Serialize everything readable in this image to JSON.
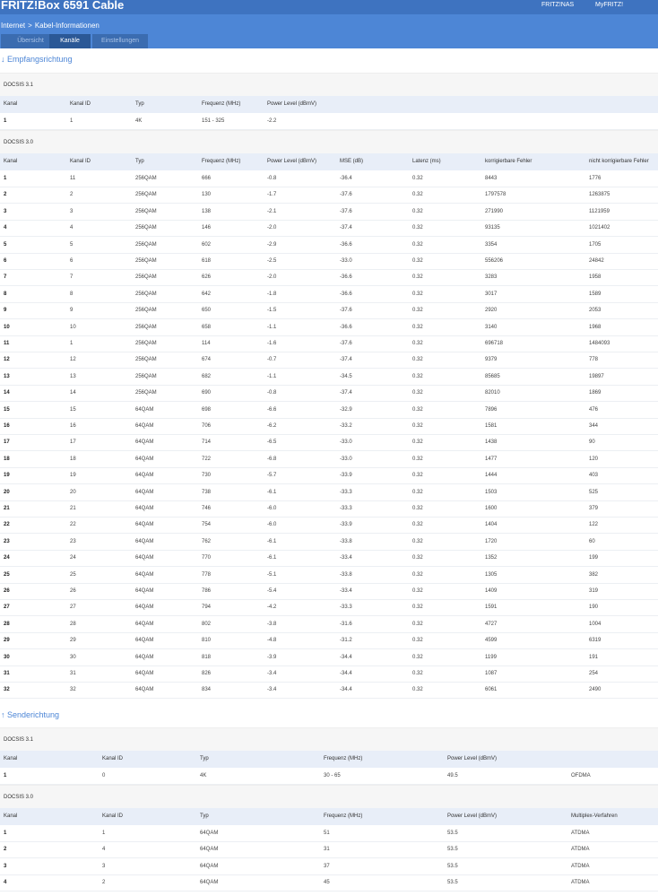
{
  "header": {
    "logo": "FRITZ!Box 6591 Cable",
    "links": [
      "FRITZ!NAS",
      "MyFRITZ!"
    ]
  },
  "breadcrumb": {
    "parent": "Internet",
    "separator": ">",
    "current": "Kabel-Informationen"
  },
  "tabs": [
    {
      "label": "Übersicht",
      "active": false
    },
    {
      "label": "Kanäle",
      "active": true
    },
    {
      "label": "Einstellungen",
      "active": false
    }
  ],
  "downstream": {
    "title": "↓ Empfangsrichtung",
    "docsis31": {
      "label": "DOCSIS 3.1",
      "headers": [
        "Kanal",
        "Kanal ID",
        "Typ",
        "Frequenz (MHz)",
        "Power Level (dBmV)"
      ],
      "rows": [
        [
          "1",
          "1",
          "4K",
          "151 - 325",
          "-2.2"
        ]
      ]
    },
    "docsis30": {
      "label": "DOCSIS 3.0",
      "headers": [
        "Kanal",
        "Kanal ID",
        "Typ",
        "Frequenz (MHz)",
        "Power Level (dBmV)",
        "MSE (dB)",
        "Latenz (ms)",
        "korrigierbare Fehler",
        "nicht korrigierbare Fehler"
      ],
      "rows": [
        [
          "1",
          "11",
          "256QAM",
          "666",
          "-0.8",
          "-36.4",
          "0.32",
          "8443",
          "1776"
        ],
        [
          "2",
          "2",
          "256QAM",
          "130",
          "-1.7",
          "-37.6",
          "0.32",
          "1797578",
          "1263875"
        ],
        [
          "3",
          "3",
          "256QAM",
          "138",
          "-2.1",
          "-37.6",
          "0.32",
          "271990",
          "1121959"
        ],
        [
          "4",
          "4",
          "256QAM",
          "146",
          "-2.0",
          "-37.4",
          "0.32",
          "93135",
          "1021402"
        ],
        [
          "5",
          "5",
          "256QAM",
          "602",
          "-2.9",
          "-36.6",
          "0.32",
          "3354",
          "1705"
        ],
        [
          "6",
          "6",
          "256QAM",
          "618",
          "-2.5",
          "-33.0",
          "0.32",
          "556206",
          "24842"
        ],
        [
          "7",
          "7",
          "256QAM",
          "626",
          "-2.0",
          "-36.6",
          "0.32",
          "3283",
          "1958"
        ],
        [
          "8",
          "8",
          "256QAM",
          "642",
          "-1.8",
          "-36.6",
          "0.32",
          "3017",
          "1589"
        ],
        [
          "9",
          "9",
          "256QAM",
          "650",
          "-1.5",
          "-37.6",
          "0.32",
          "2920",
          "2053"
        ],
        [
          "10",
          "10",
          "256QAM",
          "658",
          "-1.1",
          "-36.6",
          "0.32",
          "3140",
          "1968"
        ],
        [
          "11",
          "1",
          "256QAM",
          "114",
          "-1.6",
          "-37.6",
          "0.32",
          "696718",
          "1484093"
        ],
        [
          "12",
          "12",
          "256QAM",
          "674",
          "-0.7",
          "-37.4",
          "0.32",
          "9379",
          "778"
        ],
        [
          "13",
          "13",
          "256QAM",
          "682",
          "-1.1",
          "-34.5",
          "0.32",
          "85685",
          "19897"
        ],
        [
          "14",
          "14",
          "256QAM",
          "690",
          "-0.8",
          "-37.4",
          "0.32",
          "82010",
          "1869"
        ],
        [
          "15",
          "15",
          "64QAM",
          "698",
          "-6.6",
          "-32.9",
          "0.32",
          "7896",
          "476"
        ],
        [
          "16",
          "16",
          "64QAM",
          "706",
          "-6.2",
          "-33.2",
          "0.32",
          "1581",
          "344"
        ],
        [
          "17",
          "17",
          "64QAM",
          "714",
          "-6.5",
          "-33.0",
          "0.32",
          "1438",
          "90"
        ],
        [
          "18",
          "18",
          "64QAM",
          "722",
          "-6.8",
          "-33.0",
          "0.32",
          "1477",
          "120"
        ],
        [
          "19",
          "19",
          "64QAM",
          "730",
          "-5.7",
          "-33.9",
          "0.32",
          "1444",
          "403"
        ],
        [
          "20",
          "20",
          "64QAM",
          "738",
          "-6.1",
          "-33.3",
          "0.32",
          "1503",
          "525"
        ],
        [
          "21",
          "21",
          "64QAM",
          "746",
          "-6.0",
          "-33.3",
          "0.32",
          "1600",
          "379"
        ],
        [
          "22",
          "22",
          "64QAM",
          "754",
          "-6.0",
          "-33.9",
          "0.32",
          "1404",
          "122"
        ],
        [
          "23",
          "23",
          "64QAM",
          "762",
          "-6.1",
          "-33.8",
          "0.32",
          "1720",
          "60"
        ],
        [
          "24",
          "24",
          "64QAM",
          "770",
          "-6.1",
          "-33.4",
          "0.32",
          "1352",
          "199"
        ],
        [
          "25",
          "25",
          "64QAM",
          "778",
          "-5.1",
          "-33.8",
          "0.32",
          "1305",
          "382"
        ],
        [
          "26",
          "26",
          "64QAM",
          "786",
          "-5.4",
          "-33.4",
          "0.32",
          "1409",
          "319"
        ],
        [
          "27",
          "27",
          "64QAM",
          "794",
          "-4.2",
          "-33.3",
          "0.32",
          "1591",
          "190"
        ],
        [
          "28",
          "28",
          "64QAM",
          "802",
          "-3.8",
          "-31.6",
          "0.32",
          "4727",
          "1004"
        ],
        [
          "29",
          "29",
          "64QAM",
          "810",
          "-4.8",
          "-31.2",
          "0.32",
          "4599",
          "6319"
        ],
        [
          "30",
          "30",
          "64QAM",
          "818",
          "-3.9",
          "-34.4",
          "0.32",
          "1199",
          "191"
        ],
        [
          "31",
          "31",
          "64QAM",
          "826",
          "-3.4",
          "-34.4",
          "0.32",
          "1087",
          "254"
        ],
        [
          "32",
          "32",
          "64QAM",
          "834",
          "-3.4",
          "-34.4",
          "0.32",
          "6061",
          "2490"
        ]
      ]
    }
  },
  "upstream": {
    "title": "↑ Senderichtung",
    "docsis31": {
      "label": "DOCSIS 3.1",
      "headers": [
        "Kanal",
        "Kanal ID",
        "Typ",
        "Frequenz (MHz)",
        "Power Level (dBmV)"
      ],
      "rows": [
        [
          "1",
          "0",
          "4K",
          "30 - 65",
          "49.5",
          "OFDMA"
        ]
      ]
    },
    "docsis30": {
      "label": "DOCSIS 3.0",
      "headers": [
        "Kanal",
        "Kanal ID",
        "Typ",
        "Frequenz (MHz)",
        "Power Level (dBmV)",
        "Multiplex-Verfahren"
      ],
      "rows": [
        [
          "1",
          "1",
          "64QAM",
          "51",
          "53.5",
          "ATDMA"
        ],
        [
          "2",
          "4",
          "64QAM",
          "31",
          "53.5",
          "ATDMA"
        ],
        [
          "3",
          "3",
          "64QAM",
          "37",
          "53.5",
          "ATDMA"
        ],
        [
          "4",
          "2",
          "64QAM",
          "45",
          "53.5",
          "ATDMA"
        ]
      ]
    }
  },
  "colors": {
    "topbar": "#3e73c0",
    "navbar": "#4d86d6",
    "tab_active": "#2b5896",
    "header_row": "#e8eef8",
    "section_title": "#4d86d6"
  }
}
